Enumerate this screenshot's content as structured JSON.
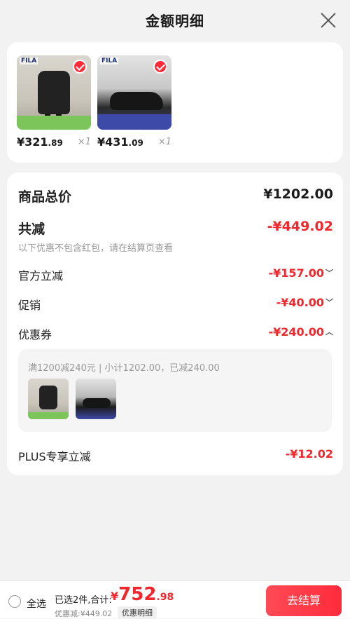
{
  "header": {
    "title": "金额明细"
  },
  "products": [
    {
      "price_int": "¥321",
      "price_dec": ".89",
      "qty": "×1",
      "logo": "FILA"
    },
    {
      "price_int": "¥431",
      "price_dec": ".09",
      "qty": "×1",
      "logo": "FILA"
    }
  ],
  "breakdown": {
    "total_label": "商品总价",
    "total_value": "¥1202.00",
    "reduce_label": "共减",
    "reduce_value": "-¥449.02",
    "reduce_note": "以下优惠不包含红包，请在结算页查看",
    "official_label": "官方立减",
    "official_value": "-¥157.00",
    "promo_label": "促销",
    "promo_value": "-¥40.00",
    "coupon_label": "优惠券",
    "coupon_value": "-¥240.00",
    "coupon_detail": "满1200减240元 | 小计1202.00，已减240.00",
    "plus_label": "PLUS专享立减",
    "plus_value": "-¥12.02"
  },
  "footer": {
    "select_all": "全选",
    "selected_summary": "已选2件,合计:",
    "total_cur": "¥",
    "total_int": "752",
    "total_frac": ".98",
    "discount_text": "优惠减:¥449.02",
    "detail_button": "优惠明细",
    "checkout_button": "去结算"
  },
  "colors": {
    "accent": "#f0272d",
    "checkout": "#ff2b3c"
  }
}
